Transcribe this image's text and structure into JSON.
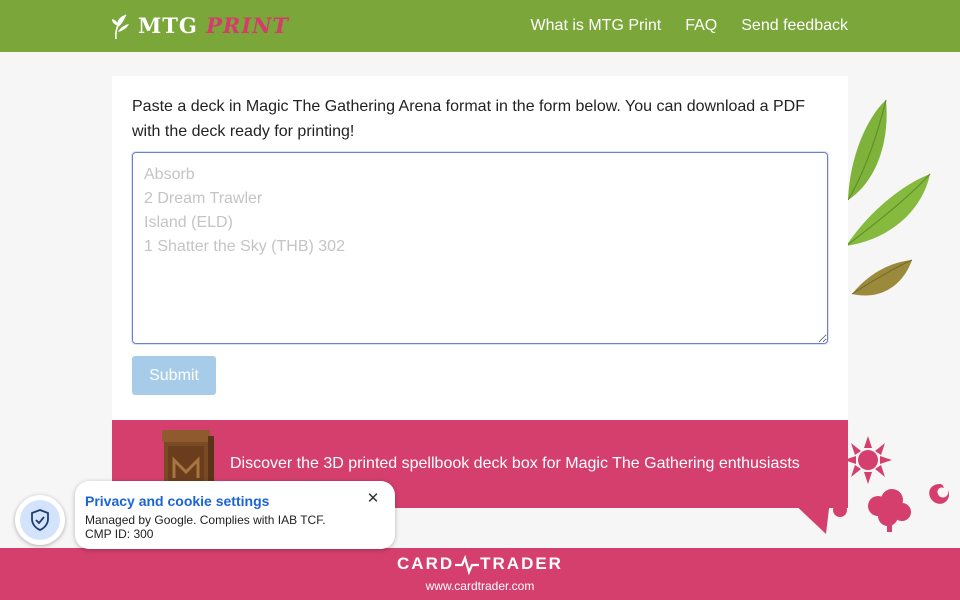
{
  "header": {
    "brand_part1": "MTG",
    "brand_part2": "PRINT",
    "nav": [
      {
        "label": "What is MTG Print"
      },
      {
        "label": "FAQ"
      },
      {
        "label": "Send feedback"
      }
    ]
  },
  "main": {
    "intro": "Paste a deck in Magic The Gathering Arena format in the form below. You can download a PDF with the deck ready for printing!",
    "deck_placeholder": "Absorb\n2 Dream Trawler\nIsland (ELD)\n1 Shatter the Sky (THB) 302",
    "submit_label": "Submit"
  },
  "promo": {
    "text": "Discover the 3D printed spellbook deck box for Magic The Gathering enthusiasts"
  },
  "footer": {
    "logo_left": "CARD",
    "logo_right": "TRADER",
    "url": "www.cardtrader.com"
  },
  "privacy": {
    "title": "Privacy and cookie settings",
    "line1": "Managed by Google. Complies with IAB TCF.",
    "line2": "CMP ID: 300",
    "close_icon": "close-icon",
    "shield_icon": "shield-check-icon"
  },
  "colors": {
    "header_green": "#7aa63a",
    "brand_pink": "#d53f6d",
    "submit_blue": "#a6cce9",
    "privacy_link": "#1a64d6"
  }
}
